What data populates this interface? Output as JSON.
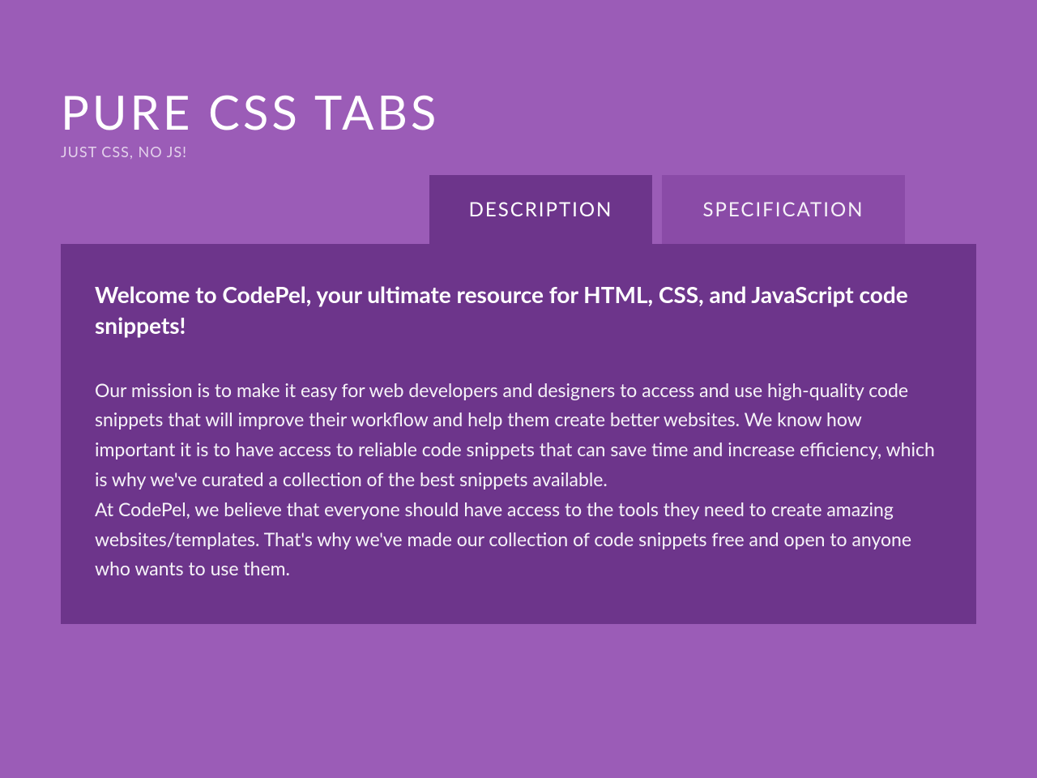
{
  "header": {
    "title": "PURE CSS TABS",
    "subtitle": "JUST CSS, NO JS!"
  },
  "tabs": {
    "active": "DESCRIPTION",
    "inactive": "SPECIFICATION"
  },
  "content": {
    "heading": "Welcome to CodePel, your ultimate resource for HTML, CSS, and JavaScript code snippets!",
    "paragraph1": "Our mission is to make it easy for web developers and designers to access and use high-quality code snippets that will improve their workflow and help them create better websites. We know how important it is to have access to reliable code snippets that can save time and increase efficiency, which is why we've curated a collection of the best snippets available.",
    "paragraph2": "At CodePel, we believe that everyone should have access to the tools they need to create amazing websites/templates. That's why we've made our collection of code snippets free and open to anyone who wants to use them."
  }
}
